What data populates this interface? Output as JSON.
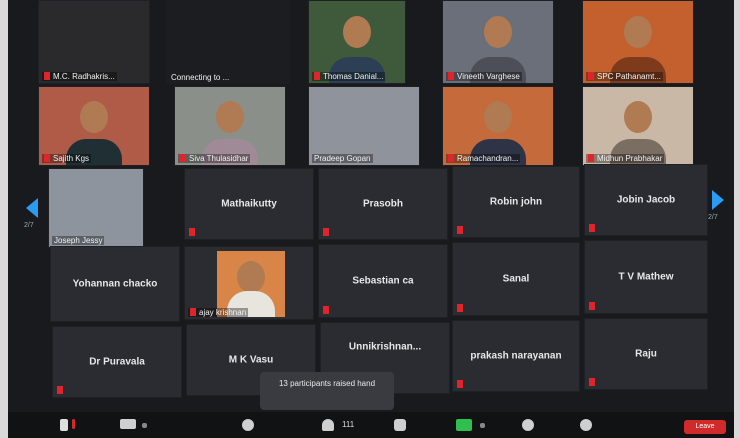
{
  "participants_page": "2/7",
  "notification": {
    "text": "13 participants raised hand"
  },
  "toolbar": {
    "participant_count": "111",
    "end_label": "Leave"
  },
  "colors": {
    "muted": "#e0242b",
    "nav_arrow": "#2b9bf4",
    "tile_bg": "#2b2c31",
    "leave": "#d12a2a"
  },
  "row1": [
    {
      "tag": "M.C. Radhakris..."
    },
    {
      "tag": "Connecting to ..."
    },
    {
      "tag": "Thomas Danial..."
    },
    {
      "tag": "Vineeth Varghese"
    },
    {
      "tag": "SPC Pathanamt..."
    }
  ],
  "row2": [
    {
      "tag": "Sajith Kgs"
    },
    {
      "tag": "Siva Thulasidhar"
    },
    {
      "tag": "Pradeep Gopan"
    },
    {
      "tag": "Ramachandran..."
    },
    {
      "tag": "Midhun Prabhakar"
    }
  ],
  "row3": [
    {
      "tag": "Joseph Jessy"
    },
    {
      "name": "Mathaikutty"
    },
    {
      "name": "Prasobh"
    },
    {
      "name": "Robin john"
    },
    {
      "name": "Jobin Jacob"
    }
  ],
  "row4": [
    {
      "name": "Yohannan chacko"
    },
    {
      "tag": "ajay krishnan"
    },
    {
      "name": "Sebastian ca"
    },
    {
      "name": "Sanal"
    },
    {
      "name": "T V Mathew"
    }
  ],
  "row5": [
    {
      "name": "Dr Puravala"
    },
    {
      "name": "M K Vasu"
    },
    {
      "name": "Unnikrishnan..."
    },
    {
      "name": "prakash narayanan"
    },
    {
      "name": "Raju"
    }
  ]
}
